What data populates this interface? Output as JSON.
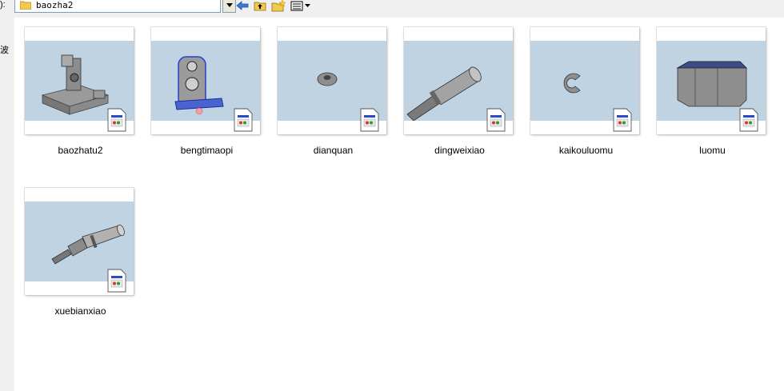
{
  "left": {
    "label_a": "):",
    "label_b": "波"
  },
  "toolbar": {
    "folder_name": "baozha2"
  },
  "files": [
    {
      "name": "baozhatu2"
    },
    {
      "name": "bengtimaopi"
    },
    {
      "name": "dianquan"
    },
    {
      "name": "dingweixiao"
    },
    {
      "name": "kaikouluomu"
    },
    {
      "name": "luomu"
    },
    {
      "name": "xuebianxiao"
    }
  ],
  "colors": {
    "thumb_bg": "#bfd3e3",
    "pane_bg": "#ffffff",
    "chrome_bg": "#f0f0f0"
  },
  "icons": [
    "folder-icon",
    "back-arrow-icon",
    "up-folder-icon",
    "new-folder-icon",
    "view-menu-icon",
    "drawing-file-icon"
  ]
}
